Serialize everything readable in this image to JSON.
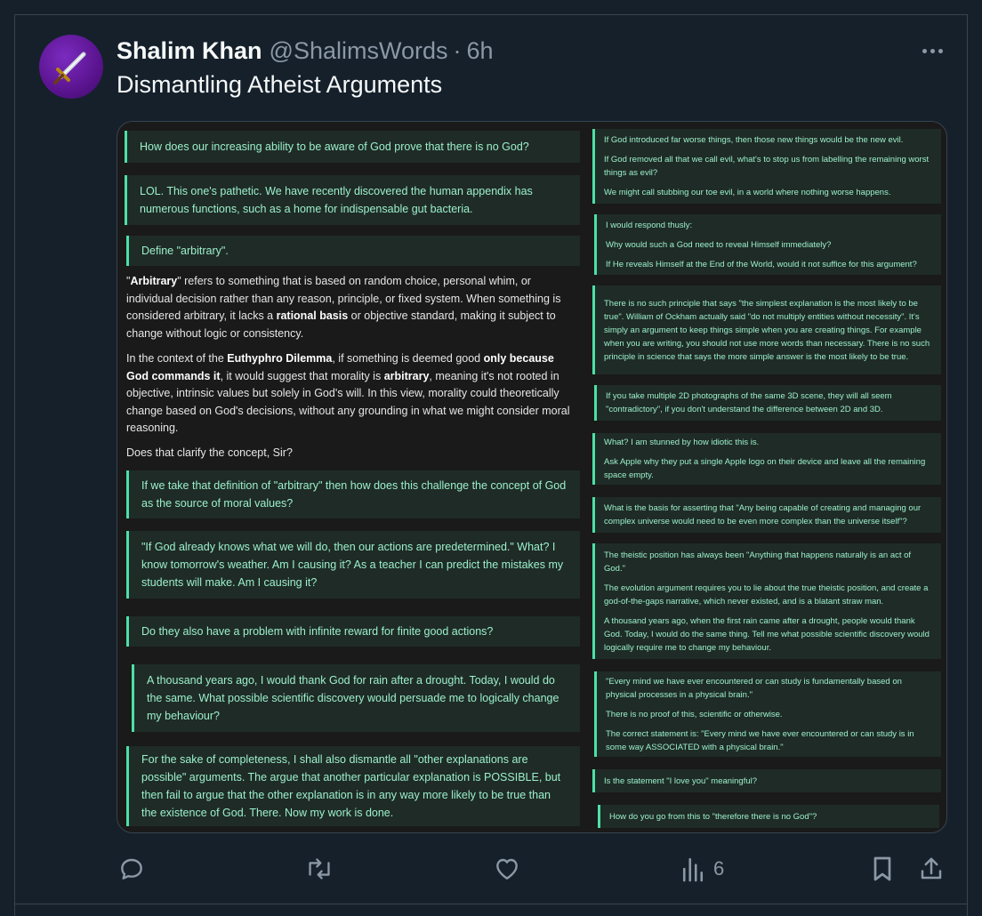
{
  "tweet": {
    "author_name": "Shalim Khan",
    "handle": "@ShalimsWords",
    "separator": "·",
    "time": "6h",
    "text": "Dismantling Atheist Arguments",
    "avatar_icon": "sword-icon"
  },
  "image_left": {
    "q1": "How does our increasing ability to be aware of God prove that there is no God?",
    "q2": "LOL. This one's pathetic. We have recently discovered the human appendix has numerous functions, such as a home for indispensable gut bacteria.",
    "q3": "Define \"arbitrary\".",
    "r1": {
      "t1": "\"",
      "b1": "Arbitrary",
      "t2": "\" refers to something that is based on random choice, personal whim, or individual decision rather than any reason, principle, or fixed system. When something is considered arbitrary, it lacks a ",
      "b2": "rational basis",
      "t3": " or objective standard, making it subject to change without logic or consistency."
    },
    "r2": {
      "t1": "In the context of the ",
      "b1": "Euthyphro Dilemma",
      "t2": ", if something is deemed good ",
      "b2": "only because God commands it",
      "t3": ", it would suggest that morality is ",
      "b3": "arbitrary",
      "t4": ", meaning it's not rooted in objective, intrinsic values but solely in God's will. In this view, morality could theoretically change based on God's decisions, without any grounding in what we might consider moral reasoning."
    },
    "r3": "Does that clarify the concept, Sir?",
    "q4": "If we take that definition of \"arbitrary\" then how does this challenge the concept of God as the source of moral values?",
    "q5": "\"If God already knows what we will do, then our actions are predetermined.\" What? I know tomorrow's weather. Am I causing it? As a teacher I can predict the mistakes my students will make. Am I causing it?",
    "q6": "Do they also have a problem with infinite reward for finite good actions?",
    "q7": "A thousand years ago, I would thank God for rain after a drought. Today, I would do the same. What possible scientific discovery would persuade me to logically change my behaviour?",
    "q8": "For the sake of completeness, I shall also dismantle all \"other explanations are possible\" arguments. The argue that another particular explanation is POSSIBLE, but then fail to argue that the other explanation is in any way more likely to be true than the existence of God. There. Now my work is done."
  },
  "image_right": {
    "b1": [
      "If God introduced far worse things, then those new things would be the new evil.",
      "If God removed all that we call evil, what's to stop us from labelling the remaining worst things as evil?",
      "We might call stubbing our toe evil, in a world where nothing worse happens."
    ],
    "b2": [
      "I would respond thusly:",
      "Why would such a God need to reveal Himself immediately?",
      "If He reveals Himself at the End of the World, would it not suffice for this argument?"
    ],
    "b3": [
      "There is no such principle that says \"the simplest explanation is the most likely to be true\". William of Ockham actually said \"do not multiply entities without necessity\". It's simply an argument to keep things simple when you are creating things. For example when you are writing, you should not use more words than necessary. There is no such principle in science that says the more simple answer is the most likely to be true."
    ],
    "b4": [
      "If you take multiple 2D photographs of the same 3D scene, they will all seem \"contradictory\", if you don't understand the difference between 2D and 3D."
    ],
    "b5": [
      "What? I am stunned by how idiotic this is.",
      "Ask Apple why they put a single Apple logo on their device and leave all the remaining space empty."
    ],
    "b6": [
      "What is the basis for asserting that \"Any being capable of creating and managing our complex universe would need to be even more complex than the universe itself\"?"
    ],
    "b7": [
      "The theistic position has always been \"Anything that happens naturally is an act of God.\"",
      "The evolution argument requires you to lie about the true theistic position, and create a god-of-the-gaps narrative, which never existed, and is a blatant straw man.",
      "A thousand years ago, when the first rain came after a drought, people would thank God. Today, I would do the same thing. Tell me what possible scientific discovery would logically require me to change my behaviour."
    ],
    "b8": [
      "\"Every mind we have ever encountered or can study is fundamentally based on physical processes in a physical brain.\"",
      "There is no proof of this, scientific or otherwise.",
      "The correct statement is: \"Every mind we have ever encountered or can study is in some way ASSOCIATED with a physical brain.\""
    ],
    "b9": [
      "Is the statement \"I love you\" meaningful?"
    ],
    "b10": [
      "How do you go from this to \"therefore there is no God\"?"
    ]
  },
  "actions": {
    "reply_icon": "reply-icon",
    "retweet_icon": "retweet-icon",
    "like_icon": "heart-icon",
    "views_icon": "views-icon",
    "views_count": "6",
    "bookmark_icon": "bookmark-icon",
    "share_icon": "share-icon"
  },
  "colors": {
    "background": "#15202b",
    "quote_text": "#9bf0cb",
    "quote_accent": "#4ce0a6",
    "secondary_text": "#8b98a5"
  }
}
